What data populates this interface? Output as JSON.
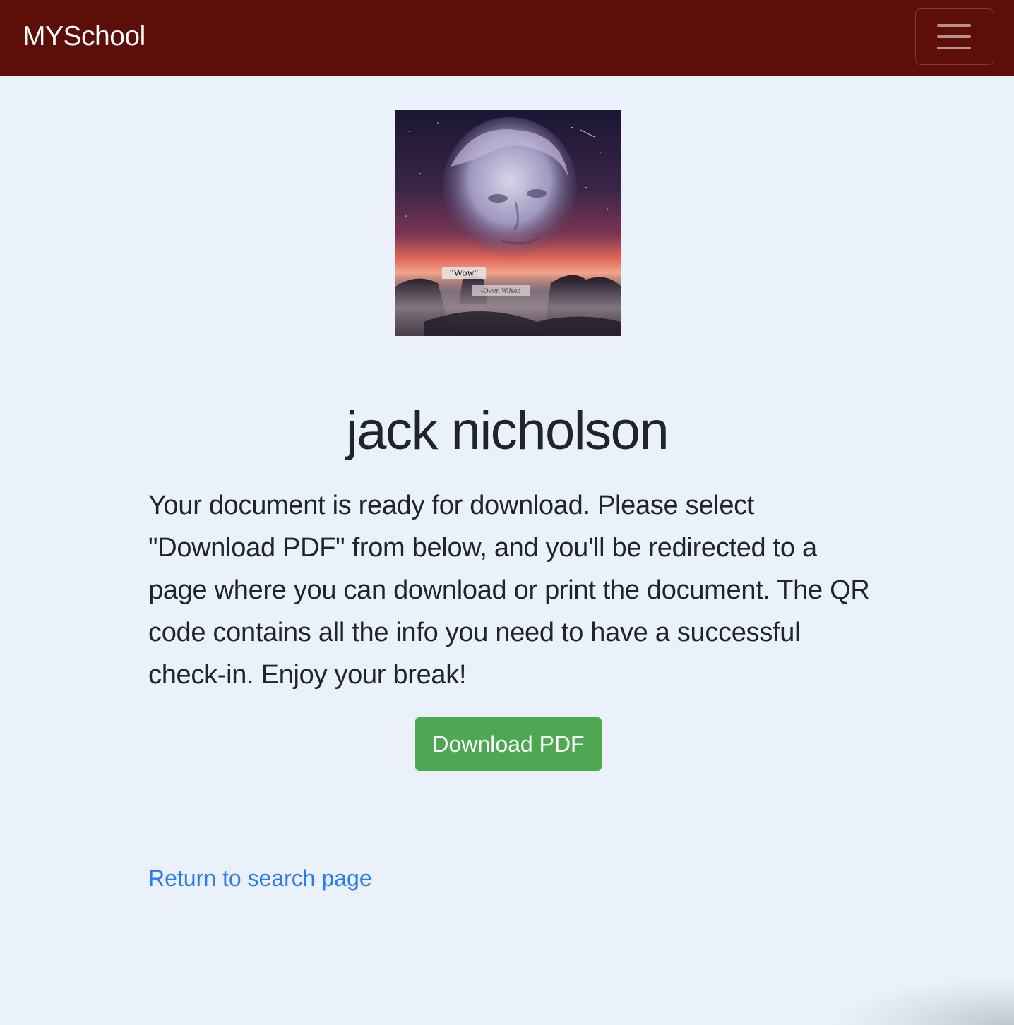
{
  "navbar": {
    "brand": "MYSchool",
    "background": "#5e0e08",
    "menu_icon": "hamburger-menu-icon"
  },
  "profile_image": {
    "caption_quote": "\"Wow\"",
    "caption_author": "-Owen Wilson"
  },
  "main": {
    "name": "jack nicholson",
    "message": "Your document is ready for download. Please select \"Download PDF\" from below, and you'll be redirected to a page where you can download or print the document. The QR code contains all the info you need to have a successful check-in. Enjoy your break!",
    "download_label": "Download PDF",
    "download_color": "#4ea752",
    "return_link": "Return to search page",
    "link_color": "#2b7bf0"
  }
}
